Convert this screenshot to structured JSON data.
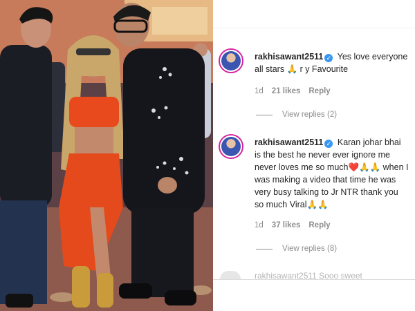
{
  "comments": [
    {
      "username": "rakhisawant2511",
      "text": "Yes love everyone all stars 🙏 r y Favourite",
      "time": "1d",
      "likes": "21 likes",
      "reply": "Reply",
      "view_replies": "View replies (2)"
    },
    {
      "username": "rakhisawant2511",
      "text": "Karan johar bhai is the best he never ever ignore me never loves me so much❤️🙏🙏 when I was making a video that time he was very busy talking to Jr NTR thank you so much Viral🙏🙏",
      "time": "1d",
      "likes": "37 likes",
      "reply": "Reply",
      "view_replies": "View replies (8)"
    }
  ],
  "partial_text": "rakhisawant2511 Sooo sweet",
  "icons": {
    "verified": "verified-badge-icon"
  },
  "colors": {
    "username": "#262626",
    "meta": "#8e8e8e",
    "verified": "#3897f0",
    "avatar_ring": "#d6249f"
  }
}
